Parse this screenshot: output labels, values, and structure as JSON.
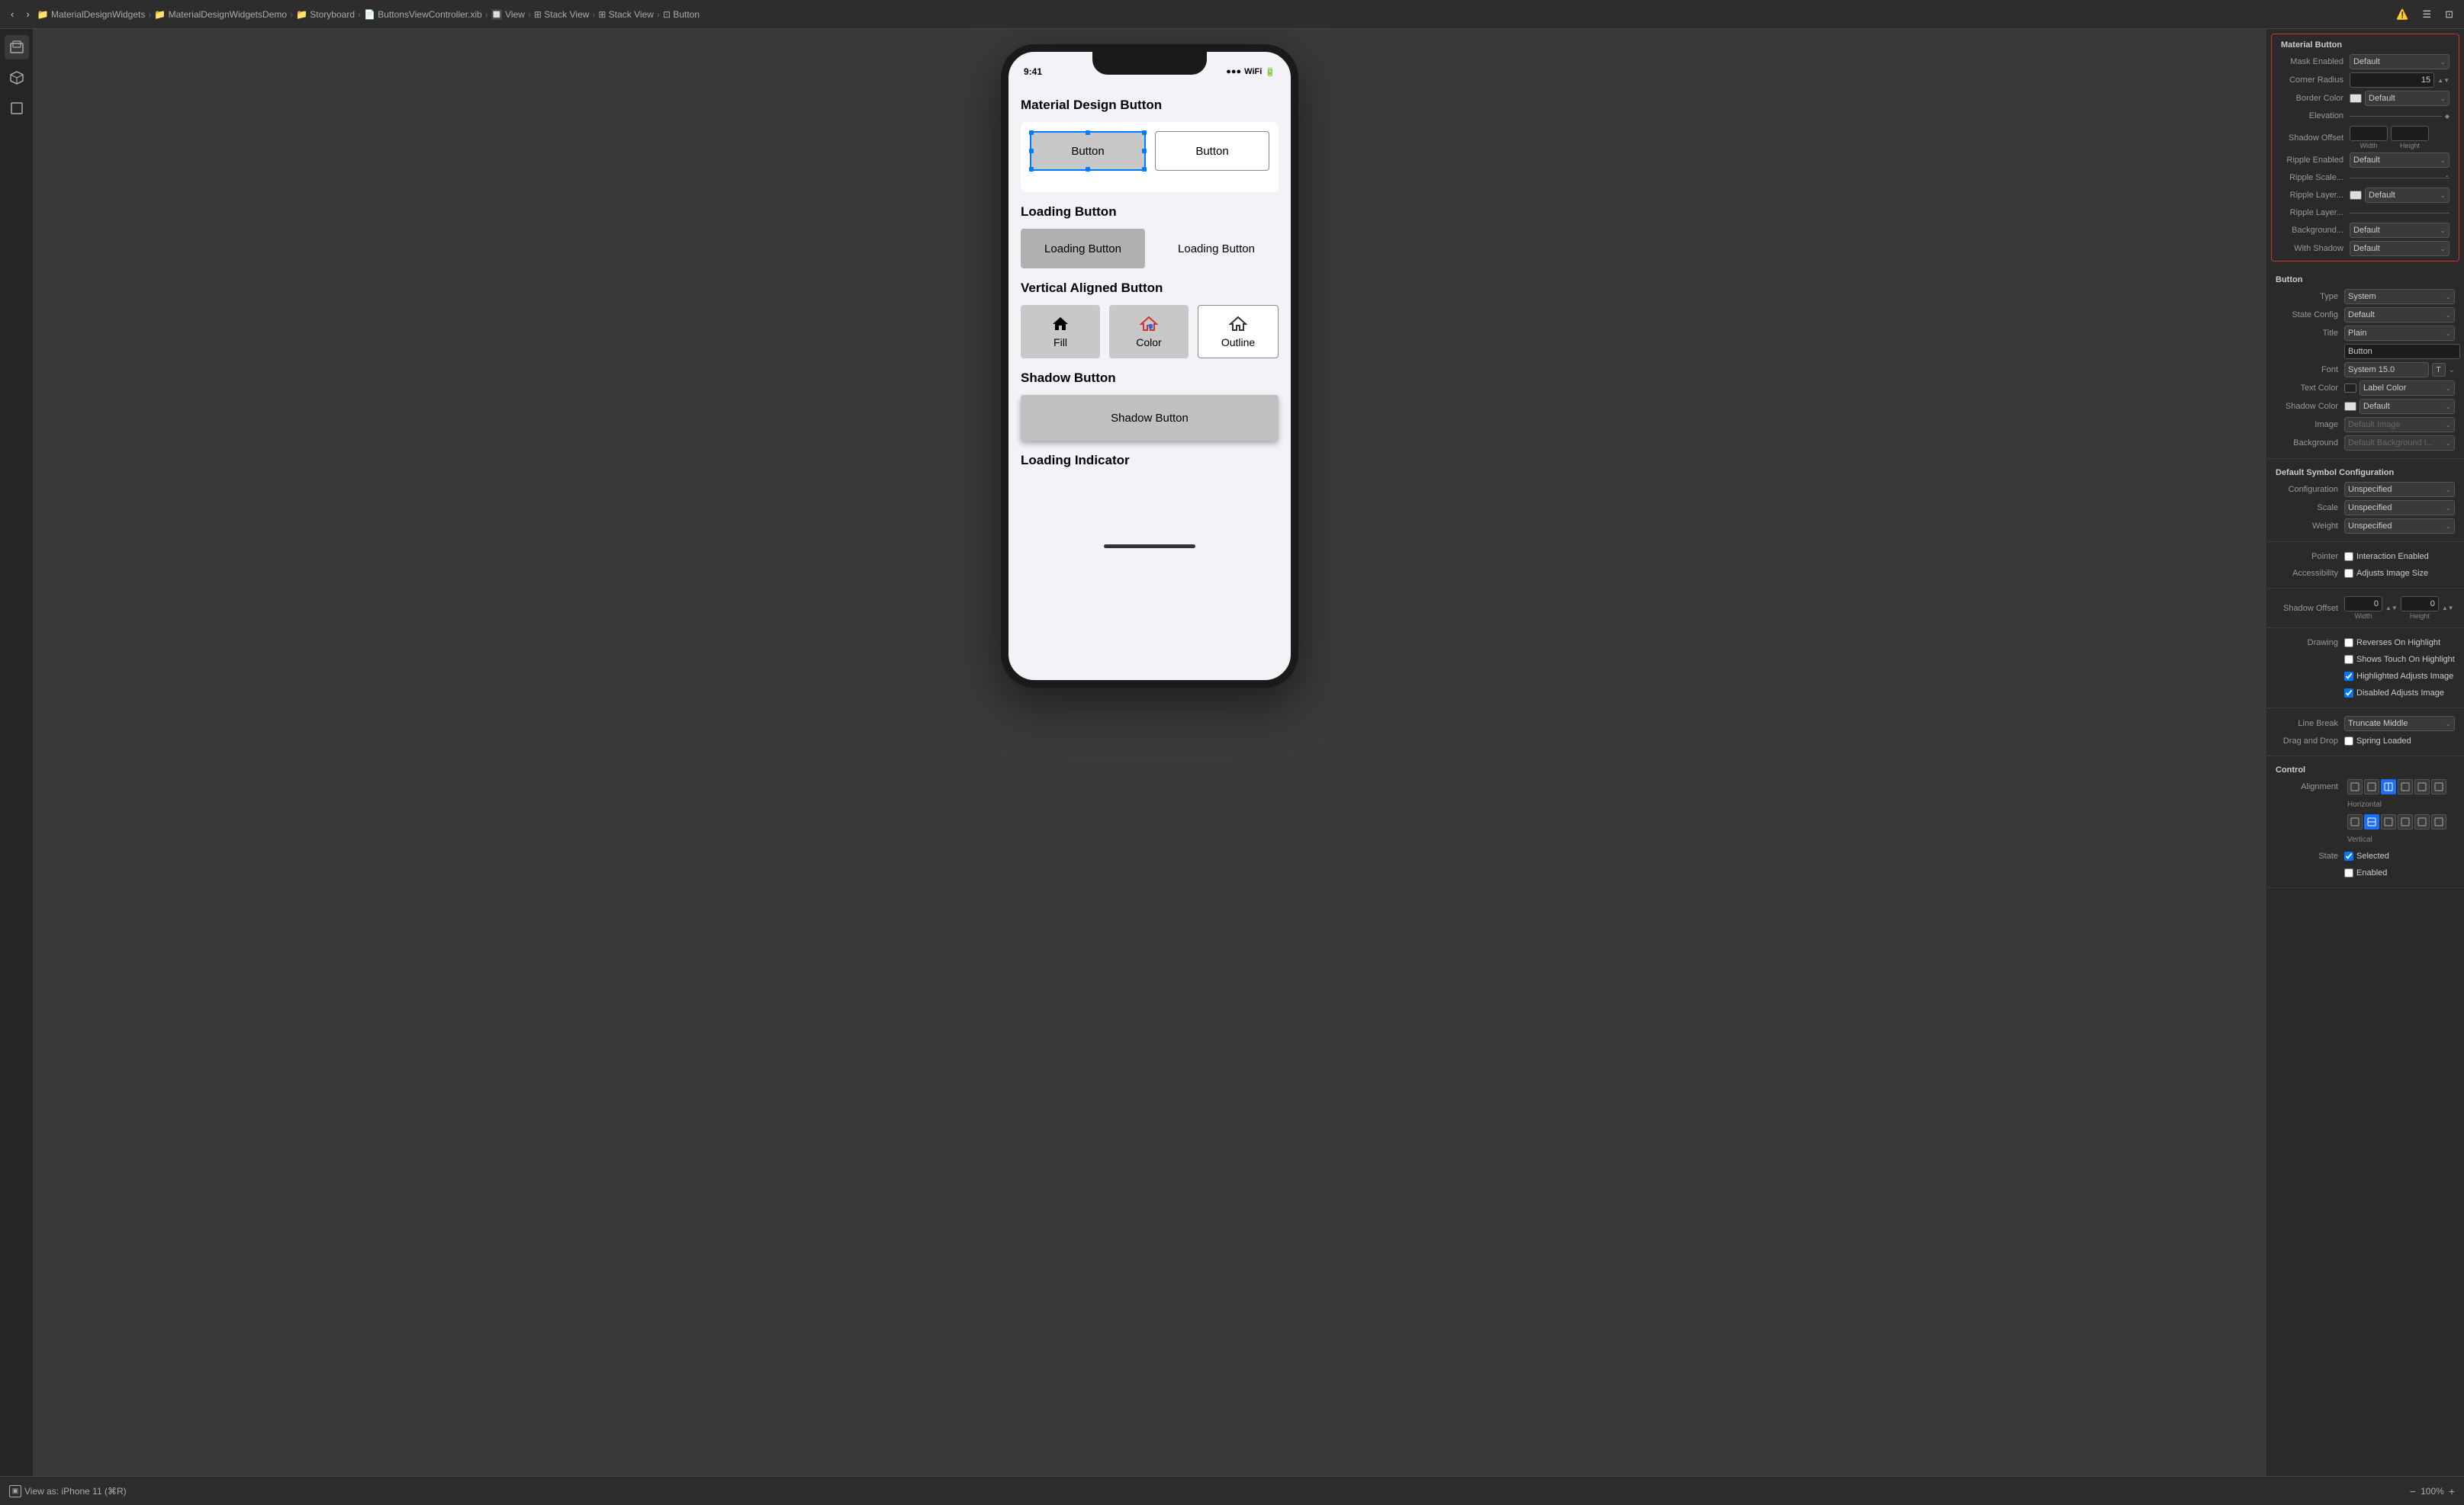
{
  "toolbar": {
    "back_btn": "‹",
    "forward_btn": "›",
    "breadcrumbs": [
      {
        "label": "MaterialDesignWidgets",
        "icon": "📁"
      },
      {
        "label": "MaterialDesignWidgetsDemo",
        "icon": "📁"
      },
      {
        "label": "Storyboard",
        "icon": "📁"
      },
      {
        "label": "ButtonsViewController.xib",
        "icon": "📄"
      },
      {
        "label": "View",
        "icon": "🔲"
      },
      {
        "label": "Stack View",
        "icon": "⊞"
      },
      {
        "label": "Stack View",
        "icon": "⊞"
      },
      {
        "label": "Button",
        "icon": "⊡"
      }
    ]
  },
  "phone": {
    "time": "9:41",
    "sections": [
      {
        "title": "Material Design Button",
        "buttons": [
          {
            "label": "Button",
            "style": "filled"
          },
          {
            "label": "Button",
            "style": "outlined"
          }
        ]
      },
      {
        "title": "Loading Button",
        "buttons": [
          {
            "label": "Loading Button",
            "style": "filled"
          },
          {
            "label": "Loading Button",
            "style": "plain"
          }
        ]
      },
      {
        "title": "Vertical Aligned Button",
        "buttons": [
          {
            "label": "Fill",
            "icon": "fill"
          },
          {
            "label": "Color",
            "icon": "color"
          },
          {
            "label": "Outline",
            "icon": "outline"
          }
        ]
      },
      {
        "title": "Shadow Button",
        "buttons": [
          {
            "label": "Shadow Button",
            "style": "shadow"
          }
        ]
      },
      {
        "title": "Loading Indicator"
      }
    ]
  },
  "right_panel": {
    "material_button_section": "Material Button",
    "fields": {
      "mask_enabled": {
        "label": "Mask Enabled",
        "value": "Default"
      },
      "corner_radius": {
        "label": "Corner Radius",
        "value": "15"
      },
      "border_color": {
        "label": "Border Color",
        "value": "Default"
      },
      "elevation": {
        "label": "Elevation",
        "value": ""
      },
      "shadow_offset_width": {
        "label": "Width",
        "value": ""
      },
      "shadow_offset_height": {
        "label": "Height",
        "value": ""
      },
      "ripple_enabled": {
        "label": "Ripple Enabled",
        "value": "Default"
      },
      "ripple_scale": {
        "label": "Ripple Scale...",
        "value": ""
      },
      "ripple_layer1": {
        "label": "Ripple Layer...",
        "value": "Default"
      },
      "ripple_layer2": {
        "label": "Ripple Layer...",
        "value": ""
      },
      "background": {
        "label": "Background...",
        "value": "Default"
      },
      "with_shadow": {
        "label": "With Shadow",
        "value": "Default"
      }
    },
    "button_section": "Button",
    "button_fields": {
      "type": {
        "label": "Type",
        "value": "System"
      },
      "state_config": {
        "label": "State Config",
        "value": "Default"
      },
      "title": {
        "label": "Title",
        "value": "Plain"
      },
      "title_value": {
        "label": "",
        "value": "Button"
      },
      "font": {
        "label": "Font",
        "value": "System 15.0"
      },
      "text_color": {
        "label": "Text Color",
        "value": "Label Color"
      },
      "shadow_color": {
        "label": "Shadow Color",
        "value": "Default"
      },
      "image": {
        "label": "Image",
        "value": "Default Image"
      },
      "background_img": {
        "label": "Background",
        "value": "Default Background I..."
      }
    },
    "symbol_section": "Default Symbol Configuration",
    "symbol_fields": {
      "configuration": {
        "label": "Configuration",
        "value": "Unspecified"
      },
      "scale": {
        "label": "Scale",
        "value": "Unspecified"
      },
      "weight": {
        "label": "Weight",
        "value": "Unspecified"
      }
    },
    "pointer_section": {
      "pointer": {
        "label": "Pointer",
        "checkbox": false,
        "value": "Interaction Enabled"
      },
      "accessibility": {
        "label": "Accessibility",
        "checkbox": false,
        "value": "Adjusts Image Size"
      }
    },
    "shadow_offset_section": {
      "label": "Shadow Offset",
      "x": "0",
      "y": "0",
      "width_label": "Width",
      "height_label": "Height"
    },
    "drawing_section": {
      "reverses": {
        "label": "Reverses On Highlight",
        "checked": false
      },
      "shows_touch": {
        "label": "Shows Touch On Highlight",
        "checked": false
      },
      "highlighted_adjusts": {
        "label": "Highlighted Adjusts Image",
        "checked": true
      },
      "disabled_adjusts": {
        "label": "Disabled Adjusts Image",
        "checked": true
      }
    },
    "line_break": {
      "label": "Line Break",
      "value": "Truncate Middle"
    },
    "drag_drop": {
      "label": "Drag and Drop",
      "value": "Spring Loaded"
    },
    "control_section": "Control",
    "alignment_section": {
      "label": "Alignment",
      "horizontal_label": "Horizontal",
      "vertical_label": "Vertical",
      "h_buttons": [
        "⬜",
        "⬜",
        "⬜",
        "⬜",
        "⬜",
        "⬜"
      ],
      "v_buttons": [
        "⬜",
        "⬜",
        "⬜",
        "⬜",
        "⬜",
        "⬜"
      ]
    },
    "state_section": {
      "selected": {
        "label": "Selected",
        "checked": true
      },
      "enabled": {
        "label": "Enabled",
        "checked": false
      }
    }
  },
  "bottom_toolbar": {
    "view_as": "View as: iPhone 11 (⌘R)",
    "zoom": "100%",
    "zoom_in": "+",
    "zoom_out": "−"
  },
  "sidebar_icons": [
    {
      "name": "cube-3d-icon",
      "symbol": "⬛"
    },
    {
      "name": "package-icon",
      "symbol": "📦"
    },
    {
      "name": "square-icon",
      "symbol": "⬜"
    }
  ]
}
